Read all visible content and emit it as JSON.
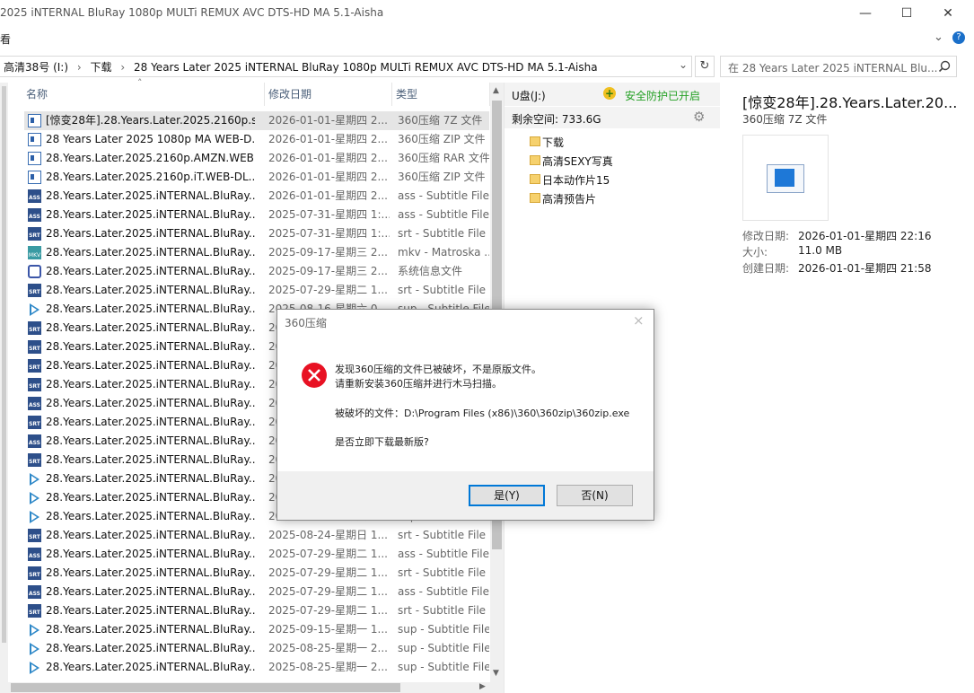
{
  "window": {
    "title": "2025 iNTERNAL BluRay 1080p MULTi REMUX AVC DTS-HD MA 5.1-Aisha",
    "minimize": "—",
    "maximize": "☐",
    "close": "✕"
  },
  "menubar": {
    "view_label": "看",
    "expand": "⌄",
    "help": "?"
  },
  "address": {
    "segments": [
      "高清38号 (I:)",
      "下载",
      "28 Years Later 2025 iNTERNAL BluRay 1080p MULTi REMUX AVC DTS-HD MA 5.1-Aisha"
    ],
    "separator": "›",
    "dropdown": "⌄",
    "refresh": "↻"
  },
  "search": {
    "placeholder": "在 28 Years Later 2025 iNTERNAL Blu...",
    "icon": "search-icon"
  },
  "columns": {
    "name": "名称",
    "date": "修改日期",
    "type": "类型",
    "sort_arrow": "˄"
  },
  "files": [
    {
      "icon": "arc",
      "name": "[惊变28年].28.Years.Later.2025.2160p.s...",
      "date": "2026-01-01-星期四 2...",
      "type": "360压缩 7Z 文件",
      "selected": true
    },
    {
      "icon": "arc",
      "name": "28 Years Later 2025 1080p MA WEB-D...",
      "date": "2026-01-01-星期四 2...",
      "type": "360压缩 ZIP 文件"
    },
    {
      "icon": "arc",
      "name": "28.Years.Later.2025.2160p.AMZN.WEB....",
      "date": "2026-01-01-星期四 2...",
      "type": "360压缩 RAR 文件"
    },
    {
      "icon": "arc",
      "name": "28.Years.Later.2025.2160p.iT.WEB-DL....",
      "date": "2026-01-01-星期四 2...",
      "type": "360压缩 ZIP 文件"
    },
    {
      "icon": "ass",
      "name": "28.Years.Later.2025.iNTERNAL.BluRay....",
      "date": "2026-01-01-星期四 2...",
      "type": "ass - Subtitle File"
    },
    {
      "icon": "ass",
      "name": "28.Years.Later.2025.iNTERNAL.BluRay....",
      "date": "2025-07-31-星期四 1:...",
      "type": "ass - Subtitle File"
    },
    {
      "icon": "srt",
      "name": "28.Years.Later.2025.iNTERNAL.BluRay....",
      "date": "2025-07-31-星期四 1:...",
      "type": "srt - Subtitle File"
    },
    {
      "icon": "mkv",
      "name": "28.Years.Later.2025.iNTERNAL.BluRay....",
      "date": "2025-09-17-星期三 2...",
      "type": "mkv - Matroska ..."
    },
    {
      "icon": "sys",
      "name": "28.Years.Later.2025.iNTERNAL.BluRay....",
      "date": "2025-09-17-星期三 2...",
      "type": "系统信息文件"
    },
    {
      "icon": "srt",
      "name": "28.Years.Later.2025.iNTERNAL.BluRay....",
      "date": "2025-07-29-星期二 1...",
      "type": "srt - Subtitle File"
    },
    {
      "icon": "play",
      "name": "28.Years.Later.2025.iNTERNAL.BluRay....",
      "date": "2025-08-16-星期六 0...",
      "type": "sup - Subtitle File"
    },
    {
      "icon": "srt",
      "name": "28.Years.Later.2025.iNTERNAL.BluRay....",
      "date": "20",
      "type": ""
    },
    {
      "icon": "srt",
      "name": "28.Years.Later.2025.iNTERNAL.BluRay....",
      "date": "20",
      "type": ""
    },
    {
      "icon": "srt",
      "name": "28.Years.Later.2025.iNTERNAL.BluRay....",
      "date": "20",
      "type": ""
    },
    {
      "icon": "srt",
      "name": "28.Years.Later.2025.iNTERNAL.BluRay....",
      "date": "20",
      "type": ""
    },
    {
      "icon": "ass",
      "name": "28.Years.Later.2025.iNTERNAL.BluRay....",
      "date": "20",
      "type": ""
    },
    {
      "icon": "srt",
      "name": "28.Years.Later.2025.iNTERNAL.BluRay....",
      "date": "20",
      "type": ""
    },
    {
      "icon": "ass",
      "name": "28.Years.Later.2025.iNTERNAL.BluRay....",
      "date": "20",
      "type": ""
    },
    {
      "icon": "srt",
      "name": "28.Years.Later.2025.iNTERNAL.BluRay....",
      "date": "20",
      "type": ""
    },
    {
      "icon": "play",
      "name": "28.Years.Later.2025.iNTERNAL.BluRay....",
      "date": "20",
      "type": ""
    },
    {
      "icon": "play",
      "name": "28.Years.Later.2025.iNTERNAL.BluRay....",
      "date": "20",
      "type": ""
    },
    {
      "icon": "play",
      "name": "28.Years.Later.2025.iNTERNAL.BluRay....",
      "date": "2025-08-23-星期六 2...",
      "type": "sup - Subtitle File"
    },
    {
      "icon": "srt",
      "name": "28.Years.Later.2025.iNTERNAL.BluRay....",
      "date": "2025-08-24-星期日 1...",
      "type": "srt - Subtitle File"
    },
    {
      "icon": "ass",
      "name": "28.Years.Later.2025.iNTERNAL.BluRay....",
      "date": "2025-07-29-星期二 1...",
      "type": "ass - Subtitle File"
    },
    {
      "icon": "srt",
      "name": "28.Years.Later.2025.iNTERNAL.BluRay....",
      "date": "2025-07-29-星期二 1...",
      "type": "srt - Subtitle File"
    },
    {
      "icon": "ass",
      "name": "28.Years.Later.2025.iNTERNAL.BluRay....",
      "date": "2025-07-29-星期二 1...",
      "type": "ass - Subtitle File"
    },
    {
      "icon": "srt",
      "name": "28.Years.Later.2025.iNTERNAL.BluRay....",
      "date": "2025-07-29-星期二 1...",
      "type": "srt - Subtitle File"
    },
    {
      "icon": "play",
      "name": "28.Years.Later.2025.iNTERNAL.BluRay....",
      "date": "2025-09-15-星期一 1...",
      "type": "sup - Subtitle File"
    },
    {
      "icon": "play",
      "name": "28.Years.Later.2025.iNTERNAL.BluRay....",
      "date": "2025-08-25-星期一 2...",
      "type": "sup - Subtitle File"
    },
    {
      "icon": "play",
      "name": "28.Years.Later.2025.iNTERNAL.BluRay....",
      "date": "2025-08-25-星期一 2...",
      "type": "sup - Subtitle File"
    }
  ],
  "udisk": {
    "title": "U盘(J:)",
    "protect": "安全防护已开启",
    "free_label": "剩余空间: 733.6G",
    "gear": "⚙",
    "folders": [
      "下载",
      "高清SEXY写真",
      "日本动作片15",
      "高清预告片"
    ]
  },
  "detail": {
    "filename": "[惊变28年].28.Years.Later.20...",
    "filetype": "360压缩 7Z 文件",
    "props": [
      {
        "label": "修改日期:",
        "value": "2026-01-01-星期四 22:16"
      },
      {
        "label": "大小:",
        "value": "11.0 MB"
      },
      {
        "label": "创建日期:",
        "value": "2026-01-01-星期四 21:58"
      }
    ]
  },
  "dialog": {
    "title": "360压缩",
    "close": "×",
    "line1": "发现360压缩的文件已被破坏，不是原版文件。",
    "line2": "请重新安装360压缩并进行木马扫描。",
    "line3": "被破坏的文件：D:\\Program Files (x86)\\360\\360zip\\360zip.exe",
    "line4": "是否立即下载最新版?",
    "yes": "是(Y)",
    "no": "否(N)"
  },
  "colors": {
    "accent": "#0078d7",
    "error": "#e81123",
    "protect_green": "#23a023",
    "selected_row": "#e5e5e5"
  }
}
